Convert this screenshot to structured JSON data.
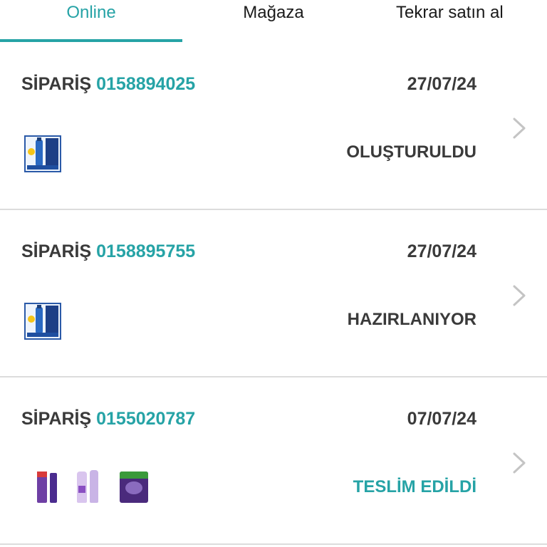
{
  "tabs": [
    {
      "label": "Online",
      "active": true
    },
    {
      "label": "Mağaza",
      "active": false
    },
    {
      "label": "Tekrar satın al",
      "active": false
    }
  ],
  "colors": {
    "accent": "#26a3a6",
    "text": "#3a3a3a",
    "divider": "#dcdcdc"
  },
  "orders": [
    {
      "prefix": "SİPARİŞ",
      "number": "0158894025",
      "date": "27/07/24",
      "status": "OLUŞTURULDU",
      "status_color": "#3a3a3a",
      "product_icons": [
        "sunscreen-product-icon"
      ]
    },
    {
      "prefix": "SİPARİŞ",
      "number": "0158895755",
      "date": "27/07/24",
      "status": "HAZIRLANIYOR",
      "status_color": "#3a3a3a",
      "product_icons": [
        "sunscreen-product-icon"
      ]
    },
    {
      "prefix": "SİPARİŞ",
      "number": "0155020787",
      "date": "07/07/24",
      "status": "TESLİM EDİLDİ",
      "status_color": "#26a3a6",
      "product_icons": [
        "serum-product-icon",
        "shampoo-product-icon",
        "pad-pack-product-icon"
      ]
    }
  ]
}
